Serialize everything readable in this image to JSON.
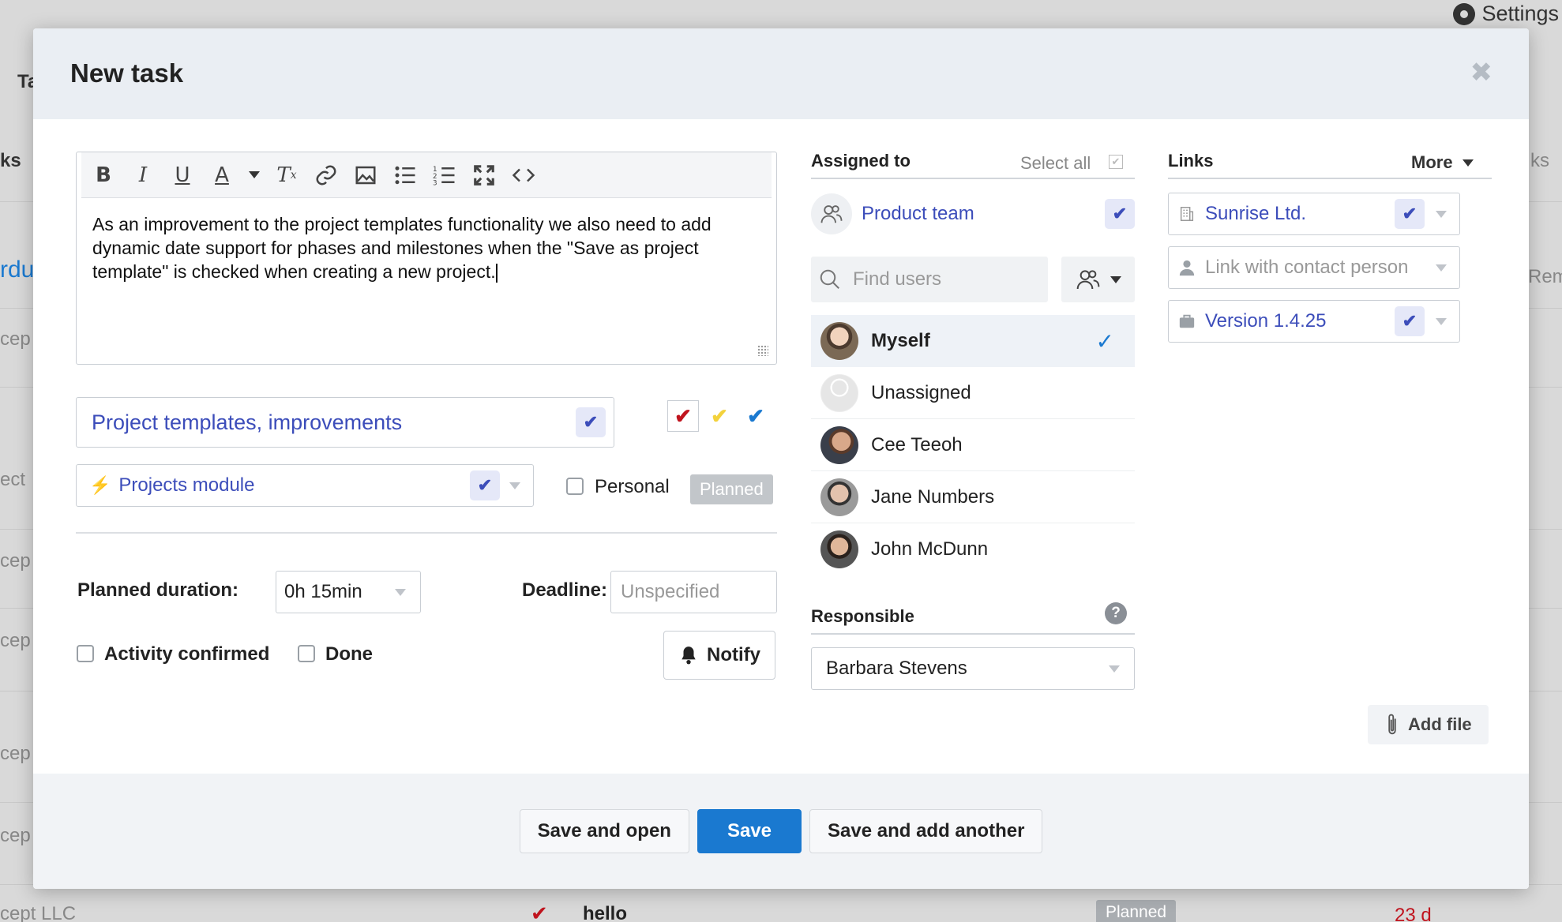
{
  "background": {
    "settings_label": "Settings",
    "tab_label": "Ta",
    "tasks_label": "ks",
    "right_tasks_label": "ks",
    "org_label": "rdu",
    "rem_label": "Rem",
    "row_texts": [
      "cep",
      "ect",
      "cep",
      "cep",
      "cep",
      "cep"
    ],
    "bottom_company": "cept LLC",
    "bottom_task": "hello",
    "bottom_badge": "Planned",
    "bottom_due": "23 d"
  },
  "modal": {
    "title": "New task",
    "close_icon": "close-icon"
  },
  "editor": {
    "toolbar": [
      "bold",
      "italic",
      "underline",
      "text-color",
      "text-color-dropdown",
      "remove-format",
      "link",
      "image",
      "bulleted-list",
      "numbered-list",
      "maximize",
      "source"
    ],
    "text": "As an improvement to the project templates functionality we also need to add dynamic date support for phases and milestones when the \"Save as project template\" is checked when creating a new project."
  },
  "task": {
    "title_value": "Project templates, improvements",
    "module_value": "Projects module",
    "personal_label": "Personal",
    "status_badge": "Planned",
    "priority_colors": [
      "#c0141e",
      "#f3d23c",
      "#1a79d0"
    ]
  },
  "planning": {
    "duration_label": "Planned duration:",
    "duration_value": "0h 15min",
    "deadline_label": "Deadline:",
    "deadline_placeholder": "Unspecified",
    "activity_label": "Activity confirmed",
    "done_label": "Done",
    "notify_label": "Notify"
  },
  "assigned": {
    "heading": "Assigned to",
    "select_all": "Select all",
    "team": "Product team",
    "search_placeholder": "Find users",
    "users": [
      {
        "name": "Myself",
        "selected": true
      },
      {
        "name": "Unassigned",
        "selected": false
      },
      {
        "name": "Cee Teeoh",
        "selected": false
      },
      {
        "name": "Jane Numbers",
        "selected": false
      },
      {
        "name": "John McDunn",
        "selected": false
      }
    ]
  },
  "responsible": {
    "heading": "Responsible",
    "value": "Barbara Stevens"
  },
  "links": {
    "heading": "Links",
    "more_label": "More",
    "company": "Sunrise Ltd.",
    "contact_placeholder": "Link with contact person",
    "version": "Version 1.4.25",
    "add_file": "Add file"
  },
  "footer": {
    "save_open": "Save and open",
    "save": "Save",
    "save_add": "Save and add another"
  }
}
